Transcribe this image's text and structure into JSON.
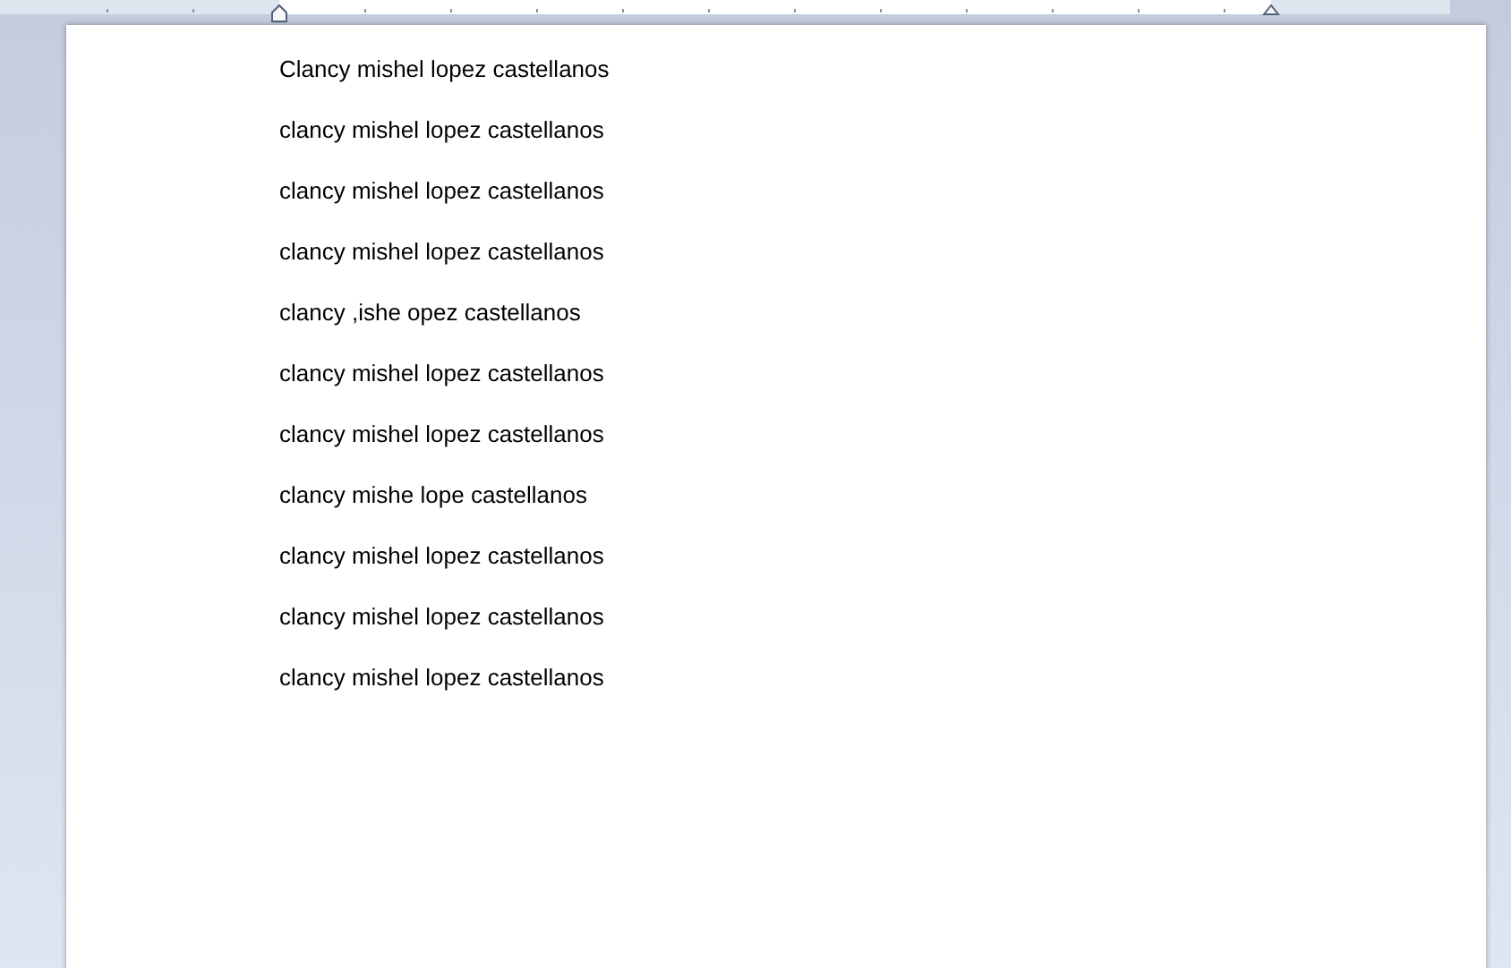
{
  "document": {
    "paragraphs": [
      "Clancy mishel lopez castellanos",
      "clancy mishel lopez castellanos",
      "clancy mishel lopez castellanos",
      "clancy mishel lopez castellanos",
      "clancy ,ishe opez castellanos",
      "clancy mishel lopez castellanos",
      "clancy mishel lopez castellanos",
      "clancy mishe lope castellanos",
      "clancy mishel lopez castellanos",
      "clancy mishel lopez castellanos",
      "clancy mishel lopez castellanos"
    ]
  }
}
